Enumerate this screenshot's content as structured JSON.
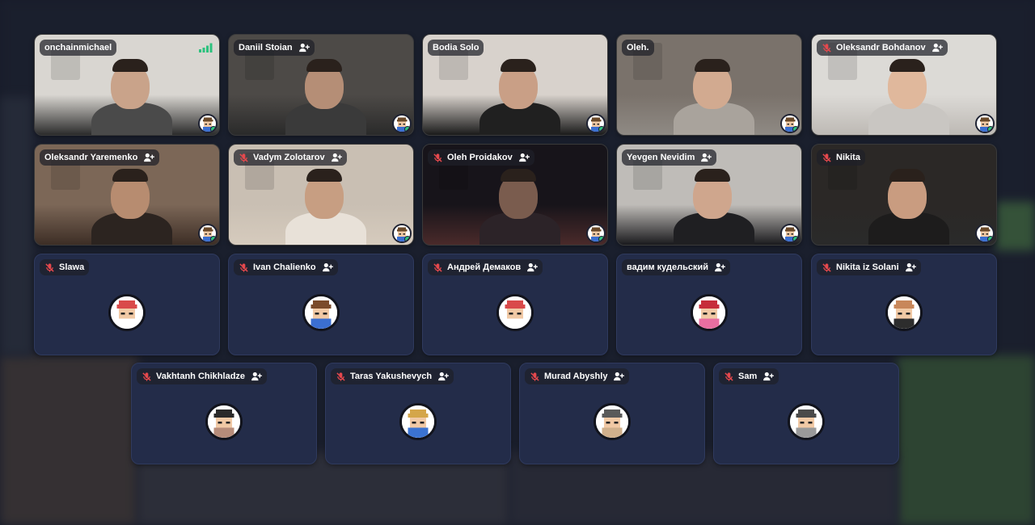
{
  "participants": [
    {
      "name": "onchainmichael",
      "muted": false,
      "add": false,
      "video": true,
      "signal": true,
      "icon": "signal-bars-icon",
      "palette": [
        "#d9d6d1",
        "#4a4a4a",
        "#2b2b2b",
        "#c9a38a"
      ]
    },
    {
      "name": "Daniil Stoian",
      "muted": false,
      "add": true,
      "video": true,
      "palette": [
        "#4d4a47",
        "#3a3a3a",
        "#2a2a2a",
        "#b58e76"
      ]
    },
    {
      "name": "Bodia Solo",
      "muted": false,
      "add": false,
      "video": true,
      "palette": [
        "#d8d2cc",
        "#202020",
        "#1a1a1a",
        "#c99f86"
      ]
    },
    {
      "name": "Oleh.",
      "muted": false,
      "add": false,
      "video": true,
      "palette": [
        "#7a726b",
        "#a9a39c",
        "#8f8a84",
        "#d2aa90"
      ]
    },
    {
      "name": "Oleksandr Bohdanov",
      "muted": true,
      "add": true,
      "video": true,
      "palette": [
        "#dcdad6",
        "#c9c6c2",
        "#bdb9b4",
        "#e0b89c"
      ]
    },
    {
      "name": "Oleksandr Yaremenko",
      "muted": false,
      "add": true,
      "video": true,
      "palette": [
        "#7c6757",
        "#2c2420",
        "#3d2e26",
        "#b78c70"
      ]
    },
    {
      "name": "Vadym Zolotarov",
      "muted": true,
      "add": true,
      "video": true,
      "palette": [
        "#c9bfb3",
        "#e8e1d8",
        "#d6cbbd",
        "#c79e82"
      ]
    },
    {
      "name": "Oleh Proidakov",
      "muted": true,
      "add": true,
      "video": true,
      "palette": [
        "#17141a",
        "#2c2328",
        "#4a2a2a",
        "#7a5c4e"
      ]
    },
    {
      "name": "Yevgen Nevidim",
      "muted": false,
      "add": true,
      "video": true,
      "palette": [
        "#bfbcb8",
        "#1f1f22",
        "#1a1a1d",
        "#cfa68d"
      ]
    },
    {
      "name": "Nikita",
      "muted": true,
      "add": false,
      "video": true,
      "palette": [
        "#2b2826",
        "#1d1c1c",
        "#2a2a2a",
        "#c99c80"
      ]
    },
    {
      "name": "Slawa",
      "muted": true,
      "add": false,
      "video": false,
      "palette": [
        "#d94a4a",
        "#ffffff"
      ]
    },
    {
      "name": "Ivan Chalienko",
      "muted": true,
      "add": true,
      "video": false,
      "palette": [
        "#7a4a2a",
        "#3b6fd1"
      ]
    },
    {
      "name": "Андрей Демаков",
      "muted": true,
      "add": true,
      "video": false,
      "palette": [
        "#d94a4a",
        "#ffffff"
      ]
    },
    {
      "name": "вадим кудельский",
      "muted": false,
      "add": true,
      "video": false,
      "palette": [
        "#c62d3a",
        "#e86ea0"
      ]
    },
    {
      "name": "Nikita iz Solani",
      "muted": true,
      "add": true,
      "video": false,
      "palette": [
        "#c8875a",
        "#2d2d2d"
      ]
    },
    {
      "name": "Vakhtanh Chikhladze",
      "muted": true,
      "add": true,
      "video": false,
      "palette": [
        "#2a2a2a",
        "#b68c7a"
      ]
    },
    {
      "name": "Taras Yakushevych",
      "muted": true,
      "add": true,
      "video": false,
      "palette": [
        "#d4a64a",
        "#3b73d1"
      ]
    },
    {
      "name": "Murad Abyshly",
      "muted": true,
      "add": true,
      "video": false,
      "palette": [
        "#5a5a5a",
        "#d0b08c"
      ]
    },
    {
      "name": "Sam",
      "muted": true,
      "add": true,
      "video": false,
      "palette": [
        "#4a4a4a",
        "#9a9a9a"
      ]
    }
  ],
  "colors": {
    "tile_bg": "#232c49",
    "online": "#2ec27e",
    "mute": "#e5484d",
    "signal": "#2ec27e"
  },
  "icons": {
    "mute": "microphone-off-icon",
    "add": "add-person-icon",
    "signal": "signal-bars-icon",
    "avatar": "pixel-avatar-icon"
  }
}
